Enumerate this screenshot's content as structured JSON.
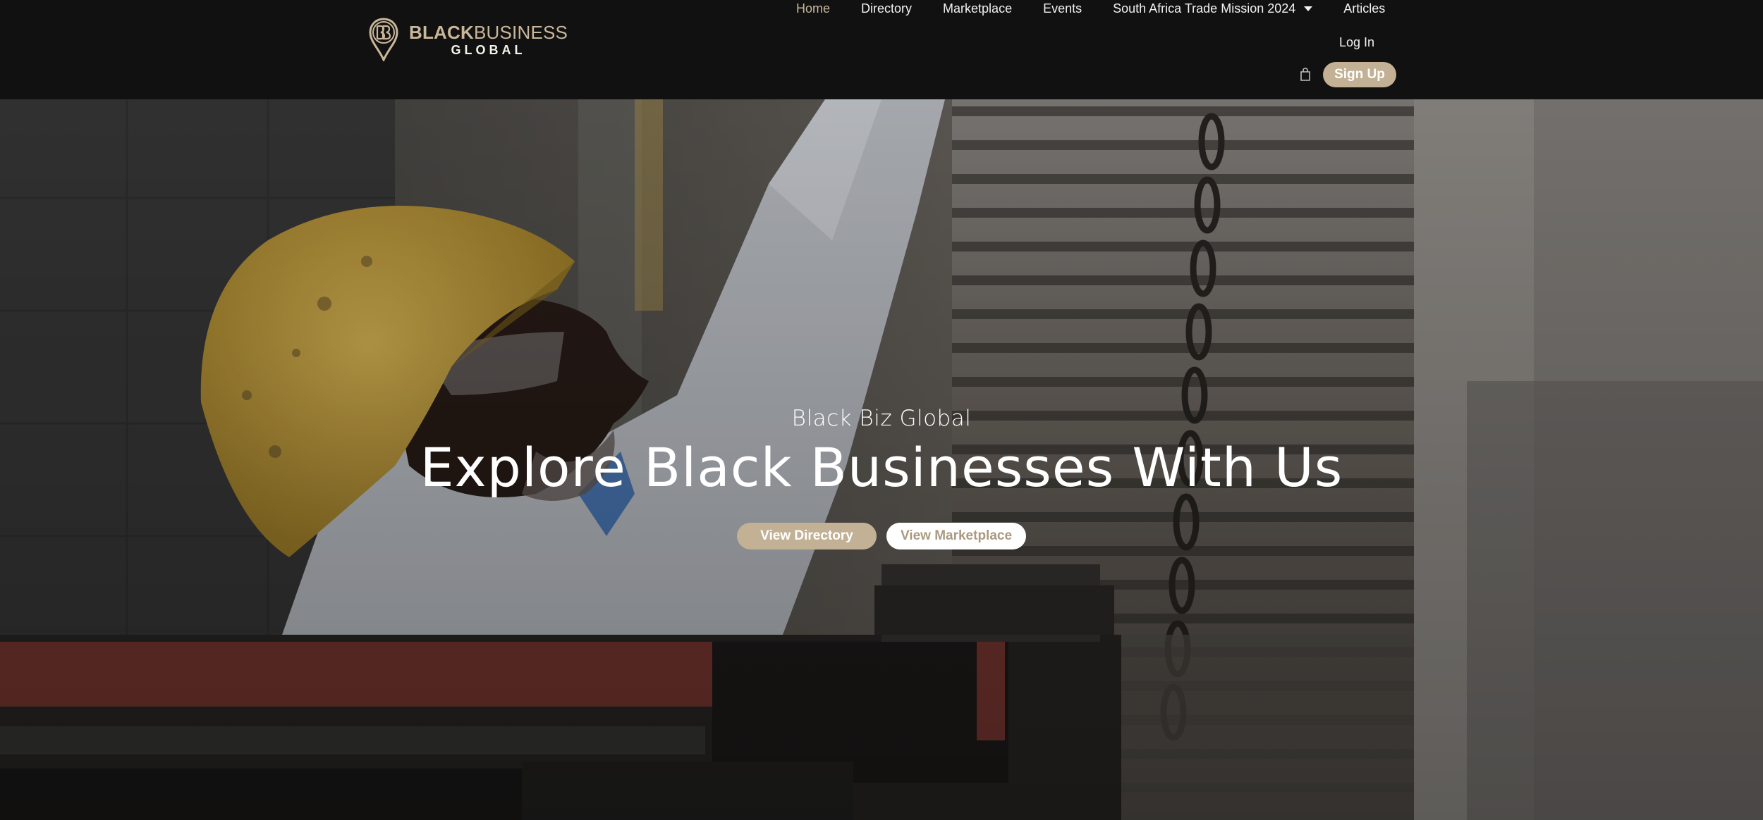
{
  "brand": {
    "logo_line1_bold": "BLACK",
    "logo_line1_rest": "BUSINESS",
    "logo_line2": "GLOBAL",
    "logo_icon": "map-pin-bb-icon",
    "colors": {
      "gold": "#c2b195",
      "header_bg": "#111111"
    }
  },
  "nav": {
    "items": [
      {
        "label": "Home",
        "active": true
      },
      {
        "label": "Directory"
      },
      {
        "label": "Marketplace"
      },
      {
        "label": "Events"
      },
      {
        "label": "South Africa Trade Mission 2024",
        "has_dropdown": true
      },
      {
        "label": "Articles"
      }
    ]
  },
  "account": {
    "login_label": "Log In",
    "signup_label": "Sign Up",
    "cart_icon": "shopping-bag-icon"
  },
  "hero": {
    "eyebrow": "Black Biz Global",
    "title": "Explore Black Businesses With Us",
    "primary_button": "View Directory",
    "secondary_button": "View Marketplace"
  }
}
